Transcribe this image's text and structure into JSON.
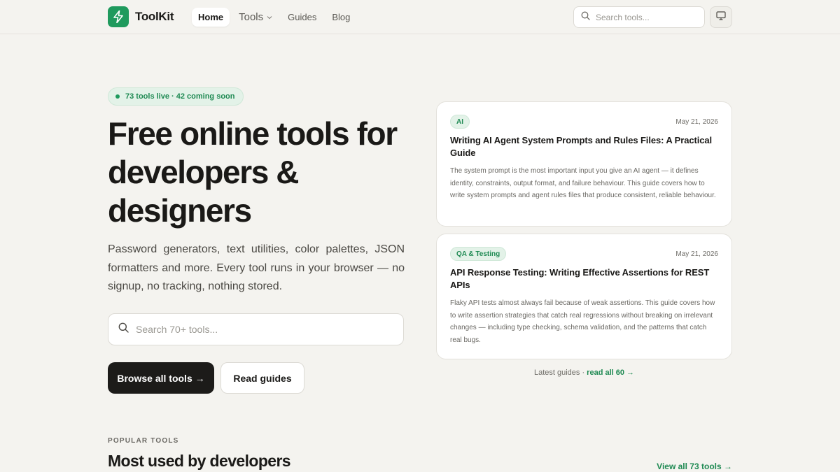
{
  "header": {
    "logo_text": "ToolKit",
    "nav": {
      "home": "Home",
      "tools": "Tools",
      "guides": "Guides",
      "blog": "Blog"
    },
    "search_placeholder": "Search tools..."
  },
  "hero": {
    "badge": "73 tools live · 42 coming soon",
    "title": "Free online tools for developers & designers",
    "subtitle": "Password generators, text utilities, color palettes, JSON formatters and more. Every tool runs in your browser — no signup, no tracking, nothing stored.",
    "search_placeholder": "Search 70+ tools...",
    "browse_label": "Browse all tools →",
    "guides_label": "Read guides"
  },
  "guides": [
    {
      "tag": "AI",
      "date": "May 21, 2026",
      "title": "Writing AI Agent System Prompts and Rules Files: A Practical Guide",
      "excerpt": "The system prompt is the most important input you give an AI agent — it defines identity, constraints, output format, and failure behaviour. This guide covers how to write system prompts and agent rules files that produce consistent, reliable behaviour."
    },
    {
      "tag": "QA & Testing",
      "date": "May 21, 2026",
      "title": "API Response Testing: Writing Effective Assertions for REST APIs",
      "excerpt": "Flaky API tests almost always fail because of weak assertions. This guide covers how to write assertion strategies that catch real regressions without breaking on irrelevant changes — including type checking, schema validation, and the patterns that catch real bugs."
    }
  ],
  "latest": {
    "prefix": "Latest guides · ",
    "link": "read all 60 →"
  },
  "popular": {
    "eyebrow": "POPULAR TOOLS",
    "title": "Most used by developers",
    "view_all": "View all 73 tools →"
  },
  "colors": {
    "background": "#f4f3ef",
    "accent": "#1f9a5d",
    "accent_text": "#1f8a53",
    "primary_button": "#1c1b19"
  },
  "icons": {
    "logo": "lightning-bolt-icon",
    "search": "search-icon",
    "theme": "monitor-icon",
    "tools_menu": "chevron-down-icon"
  }
}
